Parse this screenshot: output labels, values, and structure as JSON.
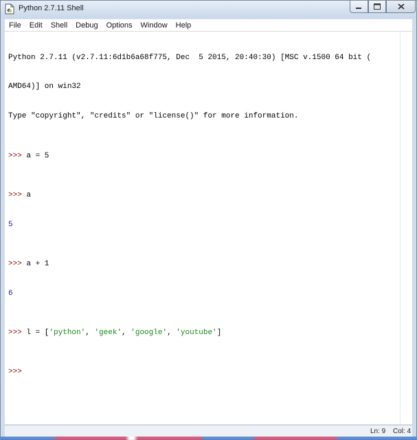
{
  "window": {
    "title": "Python 2.7.11 Shell"
  },
  "menu": [
    "File",
    "Edit",
    "Shell",
    "Debug",
    "Options",
    "Window",
    "Help"
  ],
  "console": {
    "banner1": "Python 2.7.11 (v2.7.11:6d1b6a68f775, Dec  5 2015, 20:40:30) [MSC v.1500 64 bit (",
    "banner2": "AMD64)] on win32",
    "banner3": "Type \"copyright\", \"credits\" or \"license()\" for more information.",
    "prompt": ">>> ",
    "cmd1": "a = 5",
    "cmd2": "a",
    "out2": "5",
    "cmd3": "a + 1",
    "out3": "6",
    "cmd4_pre": "l = [",
    "str1": "'python'",
    "str2": "'geek'",
    "str3": "'google'",
    "str4": "'youtube'",
    "sep": ", ",
    "cmd4_post": "]"
  },
  "status": {
    "ln": "Ln: 9",
    "col": "Col: 4"
  }
}
